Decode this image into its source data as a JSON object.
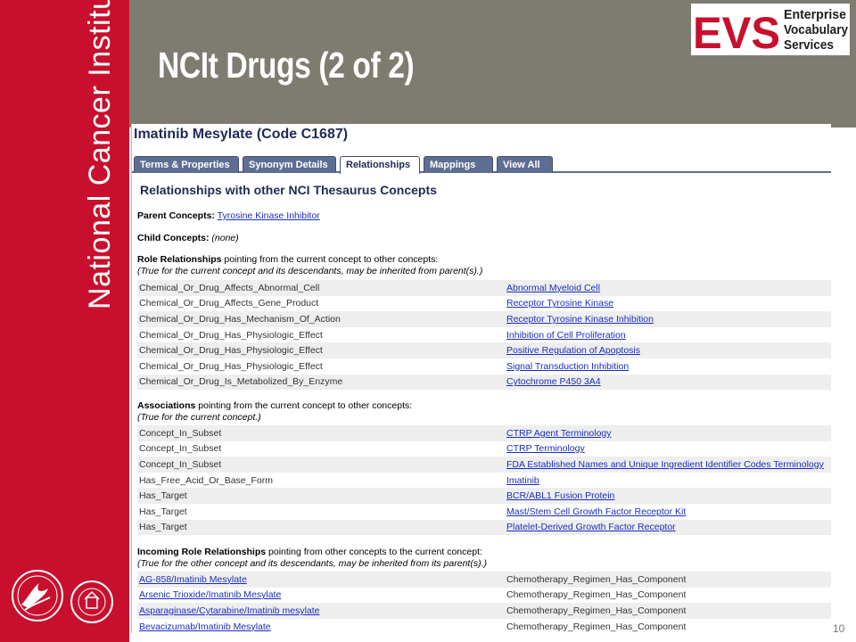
{
  "slide": {
    "title": "NCIt Drugs (2 of 2)",
    "sidebar_text": "National Cancer Institute",
    "page_number": "10"
  },
  "logo": {
    "letters": "EVS",
    "line1": "Enterprise",
    "line2": "Vocabulary",
    "line3": "Services"
  },
  "browser": {
    "concept_title": "Imatinib Mesylate (Code C1687)",
    "tabs": [
      "Terms & Properties",
      "Synonym Details",
      "Relationships",
      "Mappings",
      "View All"
    ],
    "active_tab": "Relationships",
    "section_heading": "Relationships with other NCI Thesaurus Concepts",
    "parent_label": "Parent Concepts:",
    "parent_value": "Tyrosine Kinase Inhibitor",
    "child_label": "Child Concepts:",
    "child_value": "(none)",
    "role_label": "Role Relationships",
    "role_desc": " pointing from the current concept to other concepts:",
    "role_note": "(True for the current concept and its descendants, may be inherited from parent(s).)",
    "role_rows": [
      [
        "Chemical_Or_Drug_Affects_Abnormal_Cell",
        "Abnormal Myeloid Cell"
      ],
      [
        "Chemical_Or_Drug_Affects_Gene_Product",
        "Receptor Tyrosine Kinase"
      ],
      [
        "Chemical_Or_Drug_Has_Mechanism_Of_Action",
        "Receptor Tyrosine Kinase Inhibition"
      ],
      [
        "Chemical_Or_Drug_Has_Physiologic_Effect",
        "Inhibition of Cell Proliferation"
      ],
      [
        "Chemical_Or_Drug_Has_Physiologic_Effect",
        "Positive Regulation of Apoptosis"
      ],
      [
        "Chemical_Or_Drug_Has_Physiologic_Effect",
        "Signal Transduction Inhibition"
      ],
      [
        "Chemical_Or_Drug_Is_Metabolized_By_Enzyme",
        "Cytochrome P450 3A4"
      ]
    ],
    "assoc_label": "Associations",
    "assoc_desc": " pointing from the current concept to other concepts:",
    "assoc_note": "(True for the current concept.)",
    "assoc_rows": [
      [
        "Concept_In_Subset",
        "CTRP Agent Terminology"
      ],
      [
        "Concept_In_Subset",
        "CTRP Terminology"
      ],
      [
        "Concept_In_Subset",
        "FDA Established Names and Unique Ingredient Identifier Codes Terminology"
      ],
      [
        "Has_Free_Acid_Or_Base_Form",
        "Imatinib"
      ],
      [
        "Has_Target",
        "BCR/ABL1 Fusion Protein"
      ],
      [
        "Has_Target",
        "Mast/Stem Cell Growth Factor Receptor Kit"
      ],
      [
        "Has_Target",
        "Platelet-Derived Growth Factor Receptor"
      ]
    ],
    "incoming_label": "Incoming Role Relationships",
    "incoming_desc": " pointing from other concepts to the current concept:",
    "incoming_note": "(True for the other concept and its descendants, may be inherited from its parent(s).)",
    "incoming_rows": [
      [
        "AG-858/Imatinib Mesylate",
        "Chemotherapy_Regimen_Has_Component"
      ],
      [
        "Arsenic Trioxide/Imatinib Mesylate",
        "Chemotherapy_Regimen_Has_Component"
      ],
      [
        "Asparaginase/Cytarabine/Imatinib mesylate",
        "Chemotherapy_Regimen_Has_Component"
      ],
      [
        "Bevacizumab/Imatinib Mesylate",
        "Chemotherapy_Regimen_Has_Component"
      ]
    ]
  },
  "colors": {
    "sidebar": "#c8102e",
    "header_band": "#7e7c71",
    "tab": "#5d6e92",
    "link": "#1a2dbd"
  }
}
